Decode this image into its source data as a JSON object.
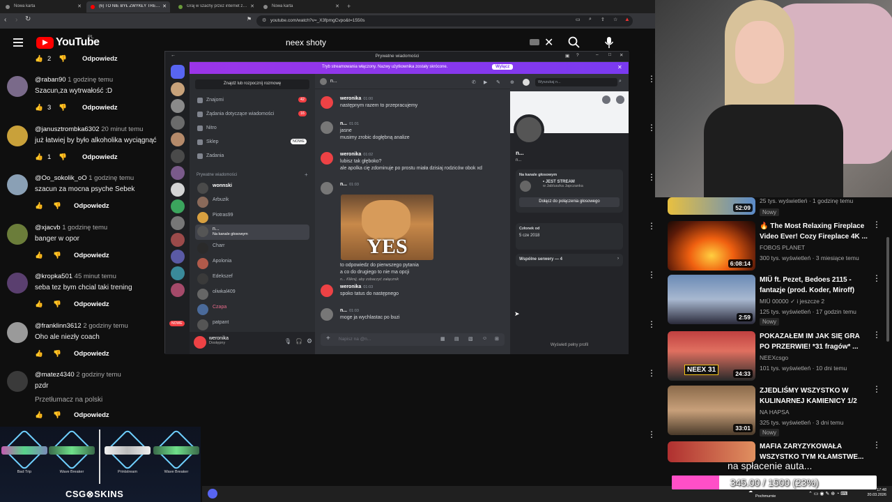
{
  "browser": {
    "tabs": [
      {
        "label": "Nowa karta"
      },
      {
        "label": "(6) TO NIE BYŁ ZWYKŁY TRENING"
      },
      {
        "label": "Graj w szachy przez internet za darmo"
      },
      {
        "label": "Nowa karta"
      }
    ],
    "url": "youtube.com/watch?v=_X3fpmgCvpo&t=1550s"
  },
  "youtube": {
    "logo_text": "YouTube",
    "country": "PL",
    "search_query": "neex shoty"
  },
  "comments": {
    "top_reply_label": "Odpowiedz",
    "top_likes": "2",
    "items": [
      {
        "author": "@raban90",
        "time": "1 godzinę temu",
        "text": "Szacun,za wytrwałość :D",
        "likes": "3",
        "reply": "Odpowiedz"
      },
      {
        "author": "@janusztrombka6302",
        "time": "20 minut temu",
        "text": "już łatwiej by było alkoholika wyciągnąć",
        "likes": "1",
        "reply": "Odpowiedz"
      },
      {
        "author": "@Oo_sokolik_oO",
        "time": "1 godzinę temu",
        "text": "szacun za mocna psyche Sebek",
        "likes": "",
        "reply": "Odpowiedz"
      },
      {
        "author": "@xjacvb",
        "time": "1 godzinę temu",
        "text": "banger w opor",
        "likes": "",
        "reply": "Odpowiedz"
      },
      {
        "author": "@kropka501",
        "time": "45 minut temu",
        "text": "seba tez bym chcial taki trening",
        "likes": "",
        "reply": "Odpowiedz"
      },
      {
        "author": "@franklinn3612",
        "time": "2 godziny temu",
        "text": "Oho ale niezły coach",
        "likes": "",
        "reply": "Odpowiedz"
      },
      {
        "author": "@matez4340",
        "time": "2 godziny temu",
        "text": "pzdr",
        "translate": "Przetłumacz na polski",
        "likes": "",
        "reply": "Odpowiedz"
      }
    ]
  },
  "discord": {
    "window_title": "Prywatne wiadomości",
    "banner_text": "Tryb streamowania włączony. Nazwy użytkownika zostały skrócone.",
    "banner_button": "Wyłącz",
    "find_label": "Znajdź lub rozpocznij rozmowę",
    "nav": [
      {
        "label": "Znajomi",
        "badge": "42"
      },
      {
        "label": "Żądania dotyczące wiadomości",
        "badge": "16"
      },
      {
        "label": "Nitro",
        "badge": ""
      },
      {
        "label": "Sklep",
        "badge": "NOWE"
      },
      {
        "label": "Zadania",
        "badge": ""
      }
    ],
    "dm_header": "Prywatne wiadomości",
    "dms": [
      {
        "name": "wonnski",
        "sub": ""
      },
      {
        "name": "Arbuzik",
        "sub": ""
      },
      {
        "name": "Piotras99",
        "sub": ""
      },
      {
        "name": "n...",
        "sub": "Na kanale głosowym"
      },
      {
        "name": "Charr",
        "sub": ""
      },
      {
        "name": "Apolonia",
        "sub": ""
      },
      {
        "name": "Edekszef",
        "sub": ""
      },
      {
        "name": "oliwkal409",
        "sub": ""
      },
      {
        "name": "Czapa",
        "sub": ""
      },
      {
        "name": "patpant",
        "sub": ""
      }
    ],
    "server_new_badge": "NOWE",
    "user": {
      "name": "weronika",
      "status": "Dostępny"
    },
    "chat_header": "n...",
    "search_placeholder": "Wyszukaj n...",
    "messages": [
      {
        "author": "weronika",
        "time": "01:00",
        "lines": [
          "następnym razem to przepracujemy"
        ]
      },
      {
        "author": "n...",
        "time": "01:01",
        "lines": [
          "jasne",
          "musimy zrobic dogłębną analize"
        ]
      },
      {
        "author": "weronika",
        "time": "01:02",
        "lines": [
          "lubisz tak głęboko?",
          "ale apolka cię zdominuje po prostu miała dzisiaj rodziców obok xd"
        ]
      },
      {
        "author": "n...",
        "time": "01:03",
        "lines": [
          "to odpowiedz do pierwszego pytania",
          "a co do drugiego to nie ma opcji"
        ],
        "image_text": "YES"
      },
      {
        "author": "weronika",
        "time": "01:03",
        "lines": [
          "spoko tatus do następnego"
        ],
        "reply_hint": "n... Kliknij, aby zobaczyć załącznik"
      },
      {
        "author": "n...",
        "time": "01:03",
        "lines": [
          "moge ja wychlastac po buzi"
        ]
      }
    ],
    "input_placeholder": "Napisz na @n...",
    "profile": {
      "name": "n...",
      "handle": "n...",
      "voice_header": "Na kanale głosowym",
      "voice_channel": "• JEST STREAM",
      "voice_server": "w Jabluszka Japczanka",
      "join_button": "Dołącz do połączenia głosowego",
      "member_since_label": "Członek od",
      "member_since": "5 cze 2018",
      "mutual_servers": "Wspólne serwery — 4",
      "full_profile": "Wyświetl pełny profil"
    }
  },
  "recommended": [
    {
      "title": "",
      "channel": "",
      "stats": "25 tys. wyświetleń · 1 godzinę temu",
      "duration": "52:09",
      "badge": "Nowy"
    },
    {
      "title": "🔥 The Most Relaxing Fireplace Video Ever! Cozy Fireplace 4K ...",
      "channel": "FOBOS PLANET",
      "stats": "300 tys. wyświetleń · 3 miesiące temu",
      "duration": "6:08:14",
      "badge": ""
    },
    {
      "title": "MIÜ ft. Pezet, Bedoes 2115 - fantazje (prod. Koder, Miroff)",
      "channel": "MIÜ 00000 ✓ i jeszcze 2",
      "stats": "125 tys. wyświetleń · 17 godzin temu",
      "duration": "2:59",
      "badge": "Nowy"
    },
    {
      "title": "POKAZAŁEM IM JAK SIĘ GRA PO PRZERWIE! *31 fragów* ...",
      "channel": "NEEXcsgo",
      "stats": "101 tys. wyświetleń · 10 dni temu",
      "duration": "24:33",
      "badge": "",
      "thumb_text": "NEEX 31"
    },
    {
      "title": "ZJEDLIŚMY WSZYSTKO W KULINARNEJ KAMIENICY 1/2",
      "channel": "NA HAPSA",
      "stats": "325 tys. wyświetleń · 3 dni temu",
      "duration": "33:01",
      "badge": "Nowy"
    },
    {
      "title": "MAFIA ZARYZYKOWAŁA WSZYSTKO TYM KŁAMSTWE...",
      "channel": "",
      "stats": "",
      "duration": "",
      "badge": ""
    }
  ],
  "csgo_overlay": {
    "skins": [
      "Bad Trip",
      "Wave Breaker",
      "Printstream",
      "Wave Breaker"
    ],
    "logo": "CSG⊗SKINS"
  },
  "donation": {
    "text": "na spłacenie auta...",
    "value_text": "345.00 / 1500 (23%)",
    "progress": 0.23
  },
  "taskbar": {
    "weather": "Pochmurnie",
    "time": "17:48",
    "date": "20.03.2026"
  },
  "colors": {
    "youtube_red": "#ff0000",
    "discord_accent": "#5865f2",
    "discord_red": "#ed4245",
    "donation_pink": "#ff4fc7"
  }
}
